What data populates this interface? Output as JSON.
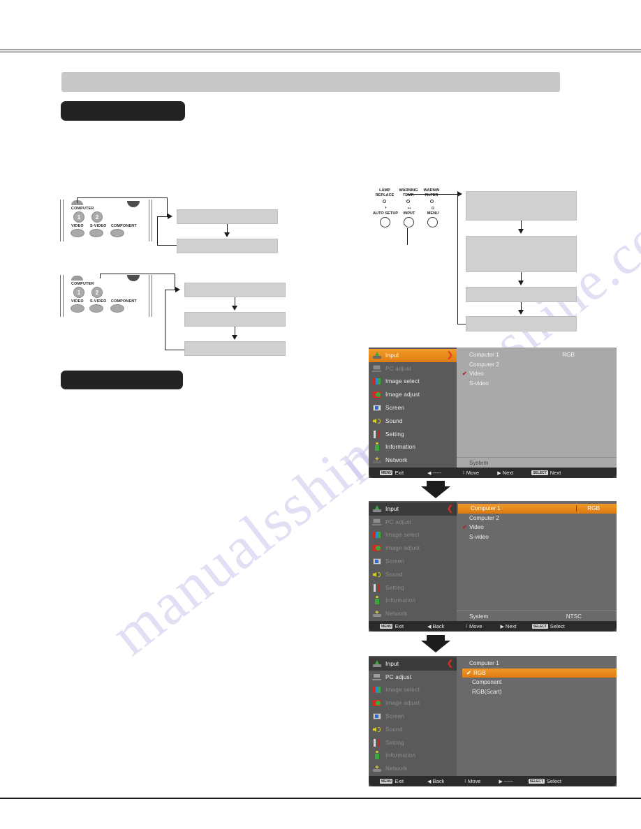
{
  "page": {
    "watermark": "manualsshine.com"
  },
  "remote_top": {
    "labels": {
      "computer": "COMPUTER",
      "btn1": "1",
      "btn2": "2",
      "video": "VIDEO",
      "svideo": "S-VIDEO",
      "component": "COMPONENT"
    }
  },
  "remote_bottom": {
    "labels": {
      "computer": "COMPUTER",
      "btn1": "1",
      "btn2": "2",
      "video": "VIDEO",
      "svideo": "S-VIDEO",
      "component": "COMPONENT"
    }
  },
  "projector_panel": {
    "indicators": [
      {
        "line1": "LAMP",
        "line2": "REPLACE"
      },
      {
        "line1": "WARNING",
        "line2": "TEMP."
      },
      {
        "line1": "WARNIN",
        "line2": "FILTER"
      }
    ],
    "buttons": [
      {
        "label": "AUTO SETUP",
        "icon": "auto-setup-icon"
      },
      {
        "label": "INPUT",
        "icon": "input-icon"
      },
      {
        "label": "MENU",
        "icon": "menu-icon"
      }
    ]
  },
  "menu_sidebar": [
    {
      "label": "Input",
      "icon": "input-icon"
    },
    {
      "label": "PC adjust",
      "icon": "pc-adjust-icon"
    },
    {
      "label": "Image select",
      "icon": "image-select-icon"
    },
    {
      "label": "Image adjust",
      "icon": "image-adjust-icon"
    },
    {
      "label": "Screen",
      "icon": "screen-icon"
    },
    {
      "label": "Sound",
      "icon": "sound-icon"
    },
    {
      "label": "Setting",
      "icon": "setting-icon"
    },
    {
      "label": "Information",
      "icon": "information-icon"
    },
    {
      "label": "Network",
      "icon": "network-icon"
    }
  ],
  "osd_menu_1": {
    "options": [
      {
        "label": "Computer 1",
        "value": "RGB",
        "checked": false
      },
      {
        "label": "Computer 2",
        "value": "",
        "checked": false
      },
      {
        "label": "Video",
        "value": "",
        "checked": true
      },
      {
        "label": "S-video",
        "value": "",
        "checked": false
      }
    ],
    "system_label": "System",
    "system_value": "",
    "footer": [
      {
        "key": "MENU",
        "label": "Exit",
        "glyph": ""
      },
      {
        "key": "",
        "label": "-----",
        "glyph": "◀"
      },
      {
        "key": "",
        "label": "Move",
        "glyph": "↕"
      },
      {
        "key": "",
        "label": "Next",
        "glyph": "▶"
      },
      {
        "key": "SELECT",
        "label": "Next",
        "glyph": ""
      }
    ]
  },
  "osd_menu_2": {
    "options": [
      {
        "label": "Computer 1",
        "value": "RGB",
        "checked": false,
        "highlighted": true
      },
      {
        "label": "Computer 2",
        "value": "",
        "checked": false
      },
      {
        "label": "Video",
        "value": "",
        "checked": true
      },
      {
        "label": "S-video",
        "value": "",
        "checked": false
      }
    ],
    "system_label": "System",
    "system_value": "NTSC",
    "footer": [
      {
        "key": "MENU",
        "label": "Exit",
        "glyph": ""
      },
      {
        "key": "",
        "label": "Back",
        "glyph": "◀"
      },
      {
        "key": "",
        "label": "Move",
        "glyph": "↕"
      },
      {
        "key": "",
        "label": "Next",
        "glyph": "▶"
      },
      {
        "key": "SELECT",
        "label": "Select",
        "glyph": ""
      }
    ]
  },
  "osd_menu_3": {
    "title": "Computer 1",
    "options": [
      {
        "label": "RGB",
        "checked": true,
        "highlighted": true
      },
      {
        "label": "Component",
        "checked": false
      },
      {
        "label": "RGB(Scart)",
        "checked": false
      }
    ],
    "footer": [
      {
        "key": "MENU",
        "label": "Exit",
        "glyph": ""
      },
      {
        "key": "",
        "label": "Back",
        "glyph": "◀"
      },
      {
        "key": "",
        "label": "Move",
        "glyph": "↕"
      },
      {
        "key": "",
        "label": "-----",
        "glyph": "▶"
      },
      {
        "key": "SELECT",
        "label": "Select",
        "glyph": ""
      }
    ]
  },
  "colors": {
    "accent_orange": "#e88a1c",
    "osd_sidebar": "#5a5a5a",
    "osd_main": "#6a6a6a",
    "osd_footer": "#2b2b2b",
    "redacted_gray": "#c8c8c8",
    "redacted_black": "#232323",
    "tick_red": "#b02018"
  }
}
